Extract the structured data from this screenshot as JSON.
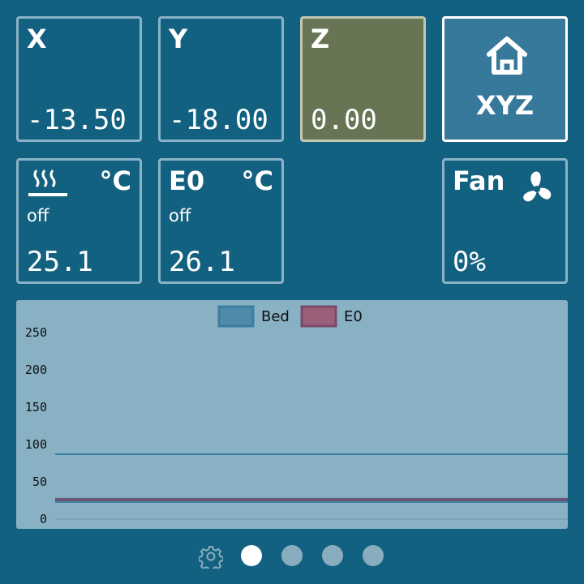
{
  "axes": {
    "x": {
      "label": "X",
      "value": "-13.50"
    },
    "y": {
      "label": "Y",
      "value": "-18.00"
    },
    "z": {
      "label": "Z",
      "value": "0.00",
      "highlight_color": "#677555"
    }
  },
  "home": {
    "label": "XYZ",
    "icon": "home-icon"
  },
  "bed": {
    "icon": "heated-bed-icon",
    "unit": "°C",
    "state": "off",
    "value": "25.1"
  },
  "e0": {
    "label": "E0",
    "unit": "°C",
    "state": "off",
    "value": "26.1"
  },
  "fan": {
    "label": "Fan",
    "icon": "fan-icon",
    "value": "0%"
  },
  "colors": {
    "background": "#136180",
    "tile_border": "#8bb3c7",
    "chart_bg": "#88b1c4",
    "bed_series": "#3a7ea1",
    "e0_series": "#7a4a6a"
  },
  "pager": {
    "pages": 4,
    "active": 1,
    "settings_icon": "gear-icon"
  },
  "chart_data": {
    "type": "line",
    "y_ticks": [
      "250",
      "200",
      "150",
      "100",
      "50",
      "0"
    ],
    "ylim": [
      0,
      250
    ],
    "legend_position": "top-center",
    "series": [
      {
        "name": "Bed",
        "color": "#3a7ea1",
        "target": 87,
        "current": 25.1
      },
      {
        "name": "E0",
        "color": "#7a4a6a",
        "target": null,
        "current": 26.1
      }
    ]
  }
}
